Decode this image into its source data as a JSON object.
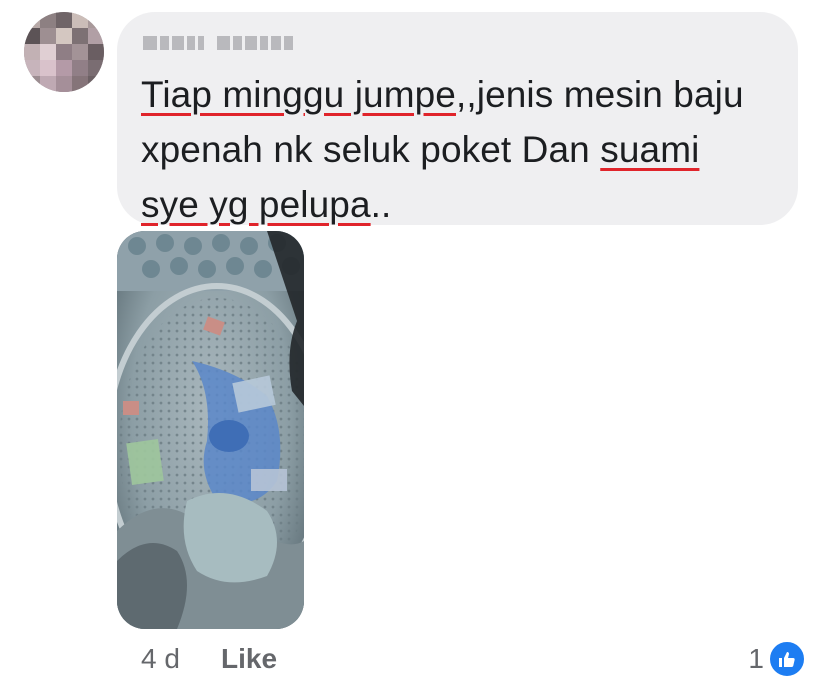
{
  "comment": {
    "author_name": "",
    "text_lines": [
      [
        {
          "text": "Tiap minggu jumpe",
          "flagged": true
        },
        {
          "text": ",,jenis mesin baju",
          "flagged": false
        }
      ],
      [
        {
          "text": "xpenah nk seluk poket Dan ",
          "flagged": false
        },
        {
          "text": "suami",
          "flagged": true
        }
      ],
      [
        {
          "text": "sye yg pelupa",
          "flagged": true
        },
        {
          "text": "..",
          "flagged": false
        }
      ]
    ],
    "spellcheck_underline_color": "#e0242b"
  },
  "attachment": {
    "type": "photo"
  },
  "footer": {
    "time": "4 d",
    "like_label": "Like",
    "reaction_count": "1",
    "reaction_icon": "thumbs-up-icon",
    "reaction_color": "#1d7df2"
  }
}
